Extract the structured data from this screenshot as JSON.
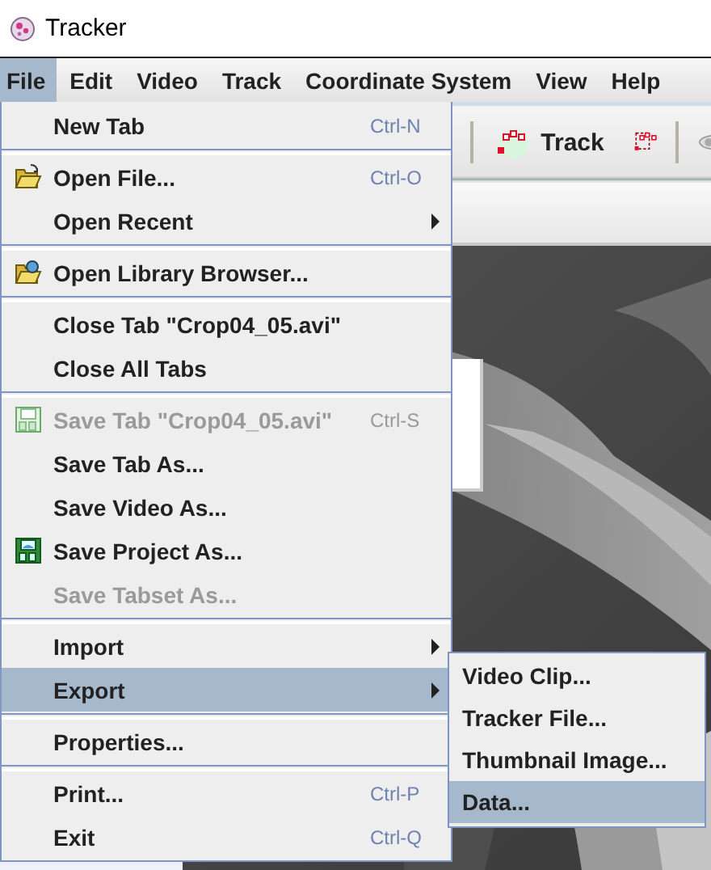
{
  "window": {
    "title": "Tracker"
  },
  "menubar": [
    {
      "label": "File",
      "selected": true
    },
    {
      "label": "Edit",
      "selected": false
    },
    {
      "label": "Video",
      "selected": false
    },
    {
      "label": "Track",
      "selected": false
    },
    {
      "label": "Coordinate System",
      "selected": false
    },
    {
      "label": "View",
      "selected": false
    },
    {
      "label": "Help",
      "selected": false
    }
  ],
  "toolbar": {
    "track_button": "Track"
  },
  "file_menu": {
    "sections": [
      [
        {
          "label": "New Tab",
          "shortcut": "Ctrl-N",
          "disabled": false,
          "submenu": false,
          "selected": false
        }
      ],
      [
        {
          "label": "Open File...",
          "shortcut": "Ctrl-O",
          "disabled": false,
          "submenu": false,
          "selected": false
        },
        {
          "label": "Open Recent",
          "disabled": false,
          "submenu": true,
          "selected": false
        }
      ],
      [
        {
          "label": "Open Library Browser...",
          "disabled": false,
          "submenu": false,
          "selected": false
        }
      ],
      [
        {
          "label": "Close Tab \"Crop04_05.avi\"",
          "disabled": false,
          "submenu": false,
          "selected": false
        },
        {
          "label": "Close All Tabs",
          "disabled": false,
          "submenu": false,
          "selected": false
        }
      ],
      [
        {
          "label": "Save Tab \"Crop04_05.avi\"",
          "shortcut": "Ctrl-S",
          "disabled": true,
          "submenu": false,
          "selected": false
        },
        {
          "label": "Save Tab As...",
          "disabled": false,
          "submenu": false,
          "selected": false
        },
        {
          "label": "Save Video As...",
          "disabled": false,
          "submenu": false,
          "selected": false
        },
        {
          "label": "Save Project As...",
          "disabled": false,
          "submenu": false,
          "selected": false
        },
        {
          "label": "Save Tabset As...",
          "disabled": true,
          "submenu": false,
          "selected": false
        }
      ],
      [
        {
          "label": "Import",
          "disabled": false,
          "submenu": true,
          "selected": false
        },
        {
          "label": "Export",
          "disabled": false,
          "submenu": true,
          "selected": true
        }
      ],
      [
        {
          "label": "Properties...",
          "disabled": false,
          "submenu": false,
          "selected": false
        }
      ],
      [
        {
          "label": "Print...",
          "shortcut": "Ctrl-P",
          "disabled": false,
          "submenu": false,
          "selected": false
        },
        {
          "label": "Exit",
          "shortcut": "Ctrl-Q",
          "disabled": false,
          "submenu": false,
          "selected": false
        }
      ]
    ]
  },
  "export_submenu": [
    {
      "label": "Video Clip...",
      "selected": false
    },
    {
      "label": "Tracker File...",
      "selected": false
    },
    {
      "label": "Thumbnail Image...",
      "selected": false
    },
    {
      "label": "Data...",
      "selected": true
    }
  ]
}
